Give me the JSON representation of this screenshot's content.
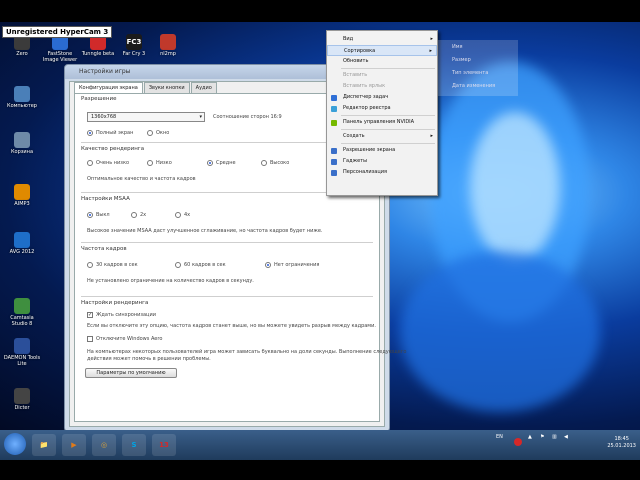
{
  "watermark": "Unregistered HyperCam 3",
  "desktop_icons": [
    {
      "label": "Zero",
      "icon": "zero-icon",
      "color": "#3b3b3b"
    },
    {
      "label": "FastStone Image Viewer",
      "icon": "faststone-icon",
      "color": "#2a6bd1"
    },
    {
      "label": "Tunngle beta",
      "icon": "tunngle-icon",
      "color": "#d12a2a"
    },
    {
      "label": "Far Cry 3",
      "icon": "farcry-icon",
      "color": "#1b1b1b",
      "glyph": "FC3"
    },
    {
      "label": "nl2mp",
      "icon": "app-icon",
      "color": "#c0392b"
    },
    {
      "label": "Компьютер",
      "icon": "computer-icon",
      "color": "#4a7fb8"
    },
    {
      "label": "Корзина",
      "icon": "recycle-bin-icon",
      "color": "#6e8aa8"
    },
    {
      "label": "AIMP3",
      "icon": "aimp-icon",
      "color": "#e08a00"
    },
    {
      "label": "AVG 2012",
      "icon": "avg-icon",
      "color": "#1e6ec9"
    },
    {
      "label": "Camtasia Studio 8",
      "icon": "camtasia-icon",
      "color": "#3f8f3f"
    },
    {
      "label": "DAEMON Tools Lite",
      "icon": "daemon-icon",
      "color": "#2b4f9a"
    },
    {
      "label": "Dicter",
      "icon": "dicter-icon",
      "color": "#444"
    }
  ],
  "window": {
    "title": "Настройки игры",
    "tabs": [
      "Конфигурация экрана",
      "Звуки кнопки",
      "Аудио"
    ],
    "resolution_header": "Разрешение",
    "resolution_value": "1360x768",
    "aspect_ratio": "Соотношение сторон 16:9",
    "fullscreen": "Полный экран",
    "windowed": "Окно",
    "quality_header": "Качество рендеринга",
    "quality_options": [
      "Очень низко",
      "Низко",
      "Средне",
      "Высоко"
    ],
    "quality_note": "Оптимальное качество и частота кадров",
    "msaa_header": "Настройки MSAA",
    "msaa_options": [
      "Выкл",
      "2x",
      "4x"
    ],
    "msaa_note": "Высокое значение MSAA даст улучшенное сглаживание, но частота кадров будет ниже.",
    "fps_header": "Частота кадров",
    "fps_options": [
      "30 кадров в сек",
      "60 кадров в сек",
      "Нет ограничения"
    ],
    "fps_note": "Не установлено ограничение на количество кадров в секунду.",
    "render_header": "Настройки рендеринга",
    "vsync": "Ждать синхронизации",
    "vsync_note": "Если вы отключите эту опцию, частота кадров станет выше, но вы можете увидеть разрыв между кадрами.",
    "aero": "Отключите Windows Aero",
    "aero_note1": "На компьютерах некоторых пользователей игра может зависать буквально на доли секунды. Выполнение следующего",
    "aero_note2": "действия может помочь в решении проблемы.",
    "defaults_button": "Параметры по умолчанию"
  },
  "context_menu": [
    {
      "label": "Вид",
      "sub": "▸"
    },
    {
      "label": "Сортировка",
      "sub": "▸",
      "hl": true
    },
    {
      "label": "Обновить"
    },
    {
      "sep": true
    },
    {
      "label": "Вставить",
      "dis": true
    },
    {
      "label": "Вставить ярлык",
      "dis": true
    },
    {
      "label": "Диспетчер задач",
      "icon": "#2f6fd6"
    },
    {
      "label": "Редактор реестра",
      "icon": "#3aa0d8"
    },
    {
      "sep": true
    },
    {
      "label": "Панель управления NVIDIA",
      "icon": "#76b900"
    },
    {
      "sep": true
    },
    {
      "label": "Создать",
      "sub": "▸"
    },
    {
      "sep": true
    },
    {
      "label": "Разрешение экрана",
      "icon": "#3a6fc9"
    },
    {
      "label": "Гаджеты",
      "icon": "#3a6fc9"
    },
    {
      "label": "Персонализация",
      "icon": "#3a6fc9"
    }
  ],
  "submenu": [
    "Имя",
    "Размер",
    "Тип элемента",
    "Дата изменения"
  ],
  "taskbar": {
    "apps": [
      {
        "name": "explorer-icon",
        "glyph": "📁",
        "color": "#e3b04b"
      },
      {
        "name": "media-player-icon",
        "glyph": "▶",
        "color": "#e07b1a"
      },
      {
        "name": "chrome-icon",
        "glyph": "◎",
        "color": "#d8a23a"
      },
      {
        "name": "skype-icon",
        "glyph": "S",
        "color": "#00a4e4"
      },
      {
        "name": "app13-icon",
        "glyph": "13",
        "color": "#d62828"
      }
    ],
    "lang": "EN",
    "time": "18:45",
    "date": "25.01.2013"
  }
}
